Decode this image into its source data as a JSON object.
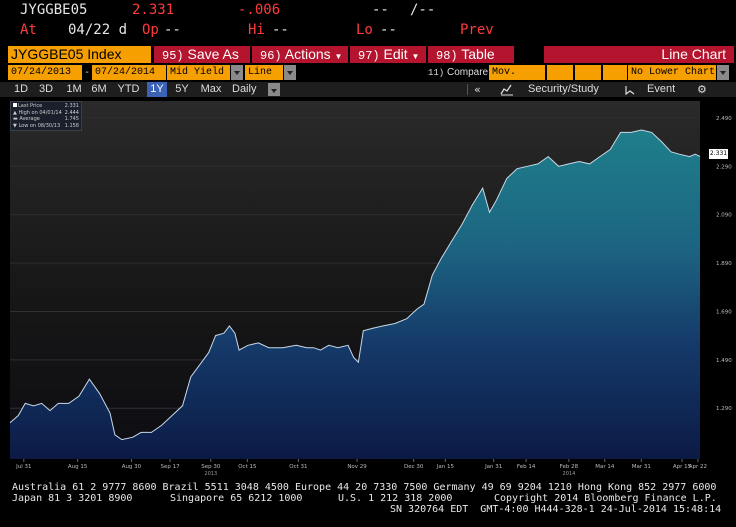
{
  "quote": {
    "ticker": "JYGGBE05",
    "last": "2.331",
    "change": "-.006",
    "dashes1": "--",
    "dashes2": "/--",
    "at_label": "At",
    "at_time": "04/22 d",
    "op_label": "Op",
    "op_value": "--",
    "hi_label": "Hi",
    "hi_value": "--",
    "lo_label": "Lo",
    "lo_value": "--",
    "prev_label": "Prev"
  },
  "cmdbar": {
    "security": "JYGGBE05 Index",
    "buttons": [
      {
        "num": "95)",
        "label": "Save As"
      },
      {
        "num": "96)",
        "label": "Actions"
      },
      {
        "num": "97)",
        "label": "Edit"
      },
      {
        "num": "98)",
        "label": "Table"
      }
    ],
    "chart_name": "Line Chart"
  },
  "params": {
    "start_date": "07/24/2013",
    "end_date": "07/24/2014",
    "field": "Mid Yield",
    "chart_style": "Line",
    "compare": "Compare",
    "compare_num": "11)",
    "mov_avgs": "Mov. Avgs",
    "lower_chart": "No Lower Chart",
    "date_sep": "-"
  },
  "periods": [
    "1D",
    "3D",
    "1M",
    "6M",
    "YTD",
    "1Y",
    "5Y",
    "Max"
  ],
  "selected_period": "1Y",
  "frequency": "Daily",
  "toolbar": {
    "collapse": "«",
    "security_study": "Security/Study",
    "event": "Event"
  },
  "legend": {
    "last_price_label": "Last Price",
    "last_price": "2.331",
    "high_label": "High on 04/01/14",
    "high": "2.444",
    "average_label": "Average",
    "average": "1.745",
    "low_label": "Low on 08/30/13",
    "low": "1.158"
  },
  "last_value_tag": "2.331",
  "chart_data": {
    "type": "area",
    "ylim": [
      1.08,
      2.56
    ],
    "y_ticks": [
      "2.490",
      "2.290",
      "2.090",
      "1.890",
      "1.690",
      "1.490",
      "1.290"
    ],
    "x_ticks": [
      "Jul 31",
      "Aug 15",
      "Aug 30",
      "Sep 17",
      "Sep 30",
      "Oct 15",
      "Oct 31",
      "Nov 29",
      "Dec 30",
      "Jan 15",
      "Jan 31",
      "Feb 14",
      "Feb 28",
      "Mar 14",
      "Mar 31",
      "Apr 15",
      "Apr 22"
    ],
    "x_tick_pos": [
      0.02,
      0.098,
      0.176,
      0.232,
      0.291,
      0.344,
      0.418,
      0.503,
      0.585,
      0.631,
      0.701,
      0.748,
      0.81,
      0.862,
      0.915,
      0.974,
      0.997
    ],
    "year_labels": [
      {
        "label": "2013",
        "pos": 0.291
      },
      {
        "label": "2014",
        "pos": 0.81
      }
    ],
    "series": [
      {
        "points": [
          [
            0.0,
            1.23
          ],
          [
            0.012,
            1.26
          ],
          [
            0.022,
            1.31
          ],
          [
            0.034,
            1.3
          ],
          [
            0.046,
            1.31
          ],
          [
            0.058,
            1.28
          ],
          [
            0.07,
            1.31
          ],
          [
            0.085,
            1.31
          ],
          [
            0.1,
            1.34
          ],
          [
            0.115,
            1.41
          ],
          [
            0.13,
            1.35
          ],
          [
            0.145,
            1.27
          ],
          [
            0.152,
            1.18
          ],
          [
            0.162,
            1.16
          ],
          [
            0.178,
            1.17
          ],
          [
            0.19,
            1.19
          ],
          [
            0.205,
            1.19
          ],
          [
            0.22,
            1.22
          ],
          [
            0.235,
            1.26
          ],
          [
            0.25,
            1.3
          ],
          [
            0.262,
            1.42
          ],
          [
            0.275,
            1.47
          ],
          [
            0.288,
            1.52
          ],
          [
            0.298,
            1.59
          ],
          [
            0.31,
            1.6
          ],
          [
            0.318,
            1.63
          ],
          [
            0.326,
            1.6
          ],
          [
            0.332,
            1.53
          ],
          [
            0.345,
            1.55
          ],
          [
            0.36,
            1.56
          ],
          [
            0.375,
            1.54
          ],
          [
            0.395,
            1.54
          ],
          [
            0.415,
            1.55
          ],
          [
            0.43,
            1.54
          ],
          [
            0.44,
            1.54
          ],
          [
            0.45,
            1.53
          ],
          [
            0.462,
            1.55
          ],
          [
            0.475,
            1.54
          ],
          [
            0.49,
            1.55
          ],
          [
            0.498,
            1.5
          ],
          [
            0.505,
            1.48
          ],
          [
            0.512,
            1.61
          ],
          [
            0.525,
            1.62
          ],
          [
            0.54,
            1.63
          ],
          [
            0.558,
            1.64
          ],
          [
            0.575,
            1.66
          ],
          [
            0.59,
            1.7
          ],
          [
            0.6,
            1.72
          ],
          [
            0.612,
            1.84
          ],
          [
            0.625,
            1.91
          ],
          [
            0.64,
            1.98
          ],
          [
            0.655,
            2.05
          ],
          [
            0.67,
            2.13
          ],
          [
            0.685,
            2.2
          ],
          [
            0.695,
            2.1
          ],
          [
            0.705,
            2.15
          ],
          [
            0.72,
            2.24
          ],
          [
            0.735,
            2.28
          ],
          [
            0.75,
            2.29
          ],
          [
            0.765,
            2.3
          ],
          [
            0.78,
            2.33
          ],
          [
            0.795,
            2.29
          ],
          [
            0.81,
            2.3
          ],
          [
            0.825,
            2.31
          ],
          [
            0.84,
            2.3
          ],
          [
            0.855,
            2.33
          ],
          [
            0.87,
            2.36
          ],
          [
            0.885,
            2.43
          ],
          [
            0.9,
            2.43
          ],
          [
            0.915,
            2.44
          ],
          [
            0.93,
            2.43
          ],
          [
            0.945,
            2.39
          ],
          [
            0.958,
            2.35
          ],
          [
            0.97,
            2.34
          ],
          [
            0.985,
            2.33
          ],
          [
            0.993,
            2.34
          ],
          [
            1.0,
            2.331
          ]
        ]
      }
    ]
  },
  "footer": {
    "line1": "Australia 61 2 9777 8600 Brazil 5511 3048 4500 Europe 44 20 7330 7500 Germany 49 69 9204 1210 Hong Kong 852 2977 6000",
    "line2a": "Japan 81 3 3201 8900",
    "line2b": "Singapore 65 6212 1000",
    "line2c": "U.S. 1 212 318 2000",
    "line2d": "Copyright 2014 Bloomberg Finance L.P.",
    "line3": "SN 320764 EDT  GMT-4:00 H444-328-1 24-Jul-2014 15:48:14"
  }
}
